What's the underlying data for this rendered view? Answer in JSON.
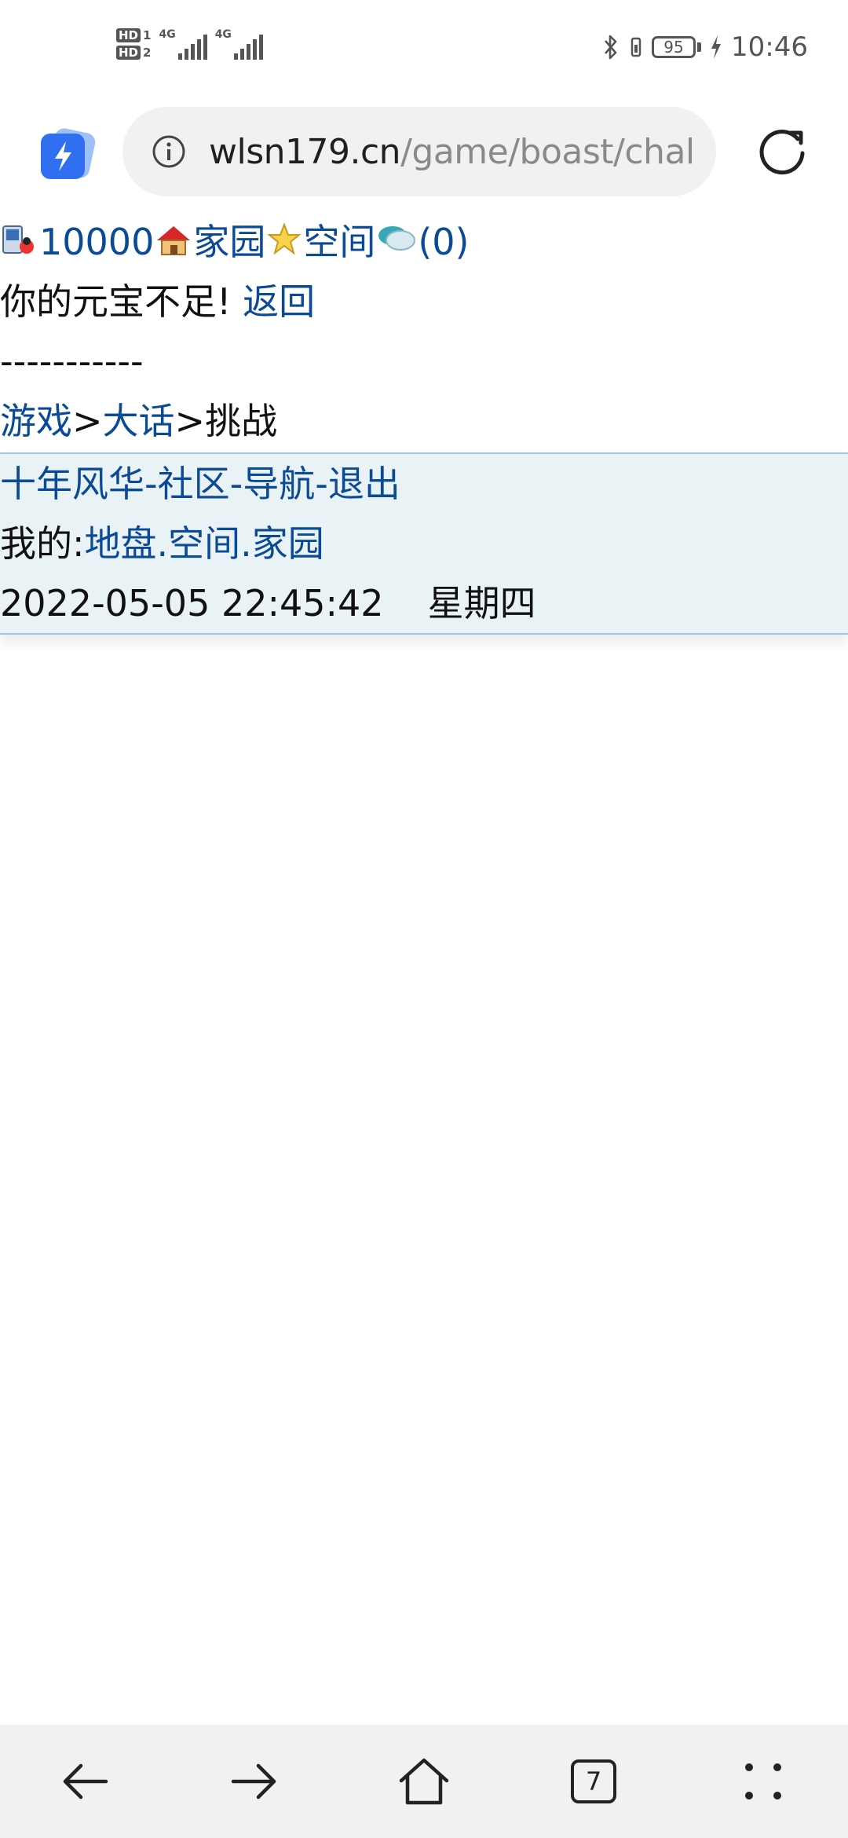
{
  "status_bar": {
    "sim1": {
      "hd": "HD",
      "slot": "1",
      "network": "4G"
    },
    "sim2": {
      "hd": "HD",
      "slot": "2",
      "network": "4G"
    },
    "battery_level": "95",
    "time": "10:46"
  },
  "browser": {
    "url_host": "wlsn179.cn",
    "url_path": "/game/boast/chal",
    "tab_count": "7"
  },
  "page": {
    "top_bar": {
      "coins": "10000",
      "home_label": "家园",
      "space_label": "空间",
      "messages": "(0)"
    },
    "message": "你的元宝不足!",
    "back_link": "返回",
    "divider": "-----------",
    "breadcrumb": {
      "game": "游戏",
      "sep1": ">",
      "dahua": "大话",
      "sep2": ">",
      "current": "挑战"
    },
    "footer": {
      "site_name": "十年风华",
      "dash1": "-",
      "community": "社区",
      "dash2": "-",
      "navigation": "导航",
      "dash3": "-",
      "logout": "退出",
      "mine_label": "我的:",
      "territory": "地盘",
      "dot1": ".",
      "space": "空间",
      "dot2": ".",
      "home": "家园",
      "datetime": "2022-05-05 22:45:42",
      "weekday": "星期四"
    }
  },
  "icons": {
    "app_badge": "lightning-app-icon",
    "info": "info-icon",
    "reload": "reload-icon",
    "back": "arrow-left-icon",
    "forward": "arrow-right-icon",
    "home": "home-icon",
    "tabs": "tabs-icon",
    "menu": "dots-menu-icon"
  },
  "colors": {
    "link": "#0a4a97",
    "footer_bg": "#e9f3f5",
    "footer_border": "#9cc6e4",
    "app_badge": "#2f6ff0"
  }
}
